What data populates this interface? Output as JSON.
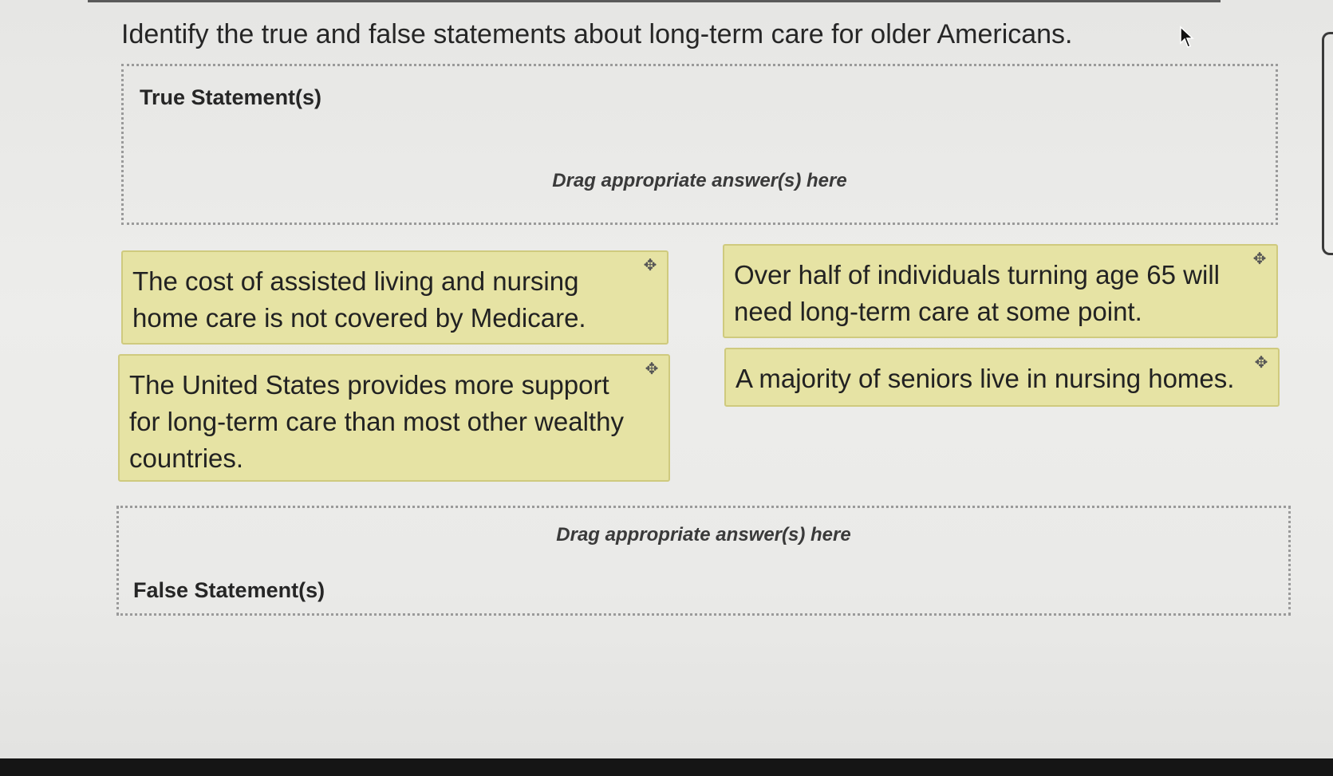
{
  "question": "Identify the true and false statements about long-term care for older Americans.",
  "true_zone": {
    "label": "True Statement(s)",
    "hint": "Drag appropriate answer(s) here"
  },
  "false_zone": {
    "label": "False Statement(s)",
    "hint": "Drag appropriate answer(s) here"
  },
  "cards": [
    {
      "text": "The cost of assisted living and nursing home care is not covered by Medicare.",
      "icon": "move-icon"
    },
    {
      "text": "Over half of individuals turning age 65 will need long-term care at some point.",
      "icon": "move-icon"
    },
    {
      "text": "The United States provides more support for long-term care than most other wealthy countries.",
      "icon": "move-icon"
    },
    {
      "text": "A majority of seniors live in nursing homes.",
      "icon": "move-icon"
    }
  ],
  "colors": {
    "card_background": "#e6e3a4",
    "card_border": "#cfca7e",
    "page_background": "#ececea"
  }
}
